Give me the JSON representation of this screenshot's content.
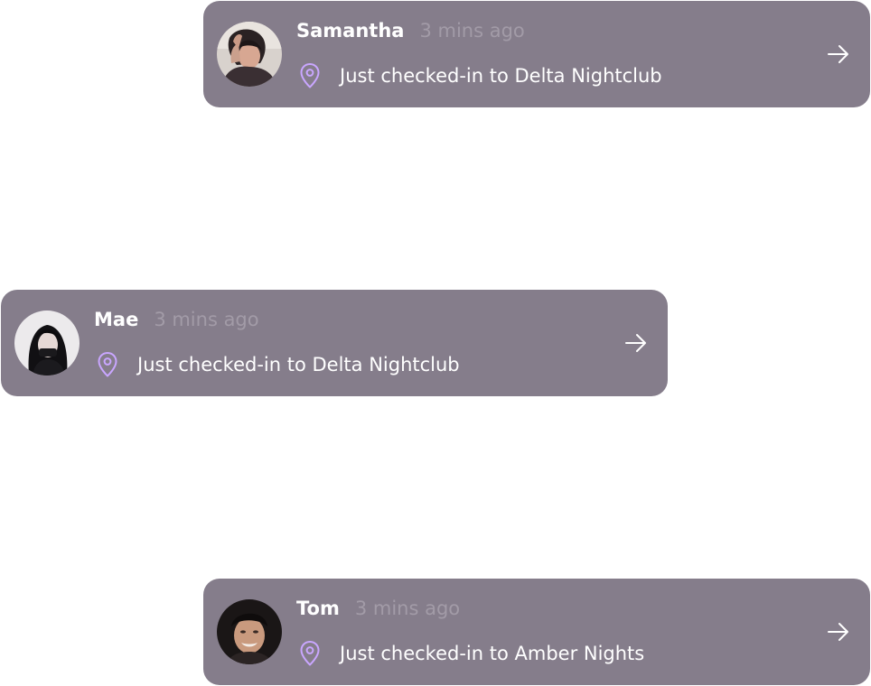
{
  "feed": {
    "items": [
      {
        "name": "Samantha",
        "time": "3 mins ago",
        "checkin_text": "Just checked-in to Delta Nightclub",
        "avatar_icon": "user-avatar-photo"
      },
      {
        "name": "Mae",
        "time": "3 mins ago",
        "checkin_text": "Just checked-in to Delta Nightclub",
        "avatar_icon": "user-avatar-photo"
      },
      {
        "name": "Tom",
        "time": "3 mins ago",
        "checkin_text": "Just checked-in to Amber Nights",
        "avatar_icon": "user-avatar-photo"
      }
    ]
  },
  "colors": {
    "card_background": "#857d8b",
    "name_text": "#ffffff",
    "time_text": "#a29ba7",
    "pin_icon": "#c9a6ff",
    "arrow_icon": "#ffffff"
  },
  "icons": {
    "location": "location-pin-icon",
    "navigate": "arrow-right-icon"
  }
}
